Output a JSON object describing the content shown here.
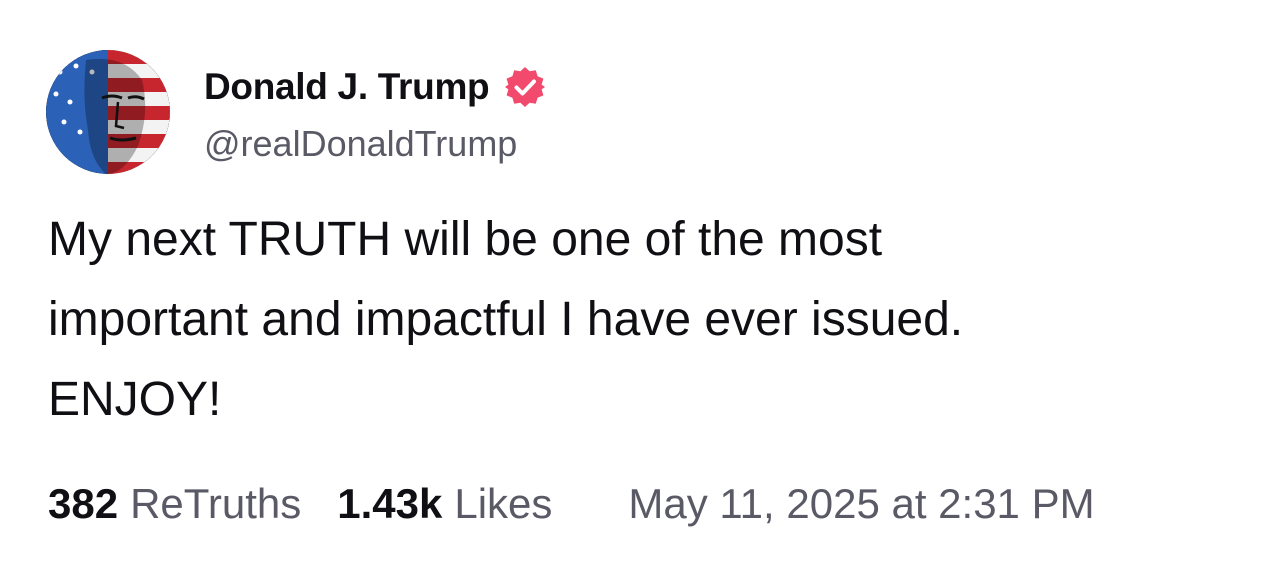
{
  "author": {
    "display_name": "Donald J. Trump",
    "handle": "@realDonaldTrump",
    "verified_icon": "verified-badge-icon",
    "verified_color": "#f24a6d",
    "avatar": "flag-portrait-avatar"
  },
  "post": {
    "text": "My next TRUTH will be one of the most\nimportant and impactful I have ever issued.\nENJOY!"
  },
  "stats": {
    "retruths_count": "382",
    "retruths_label": "ReTruths",
    "likes_count": "1.43k",
    "likes_label": "Likes",
    "timestamp": "May 11, 2025 at 2:31 PM"
  },
  "colors": {
    "text_primary": "#0f0f14",
    "text_secondary": "#5a5a66",
    "background": "#ffffff"
  }
}
